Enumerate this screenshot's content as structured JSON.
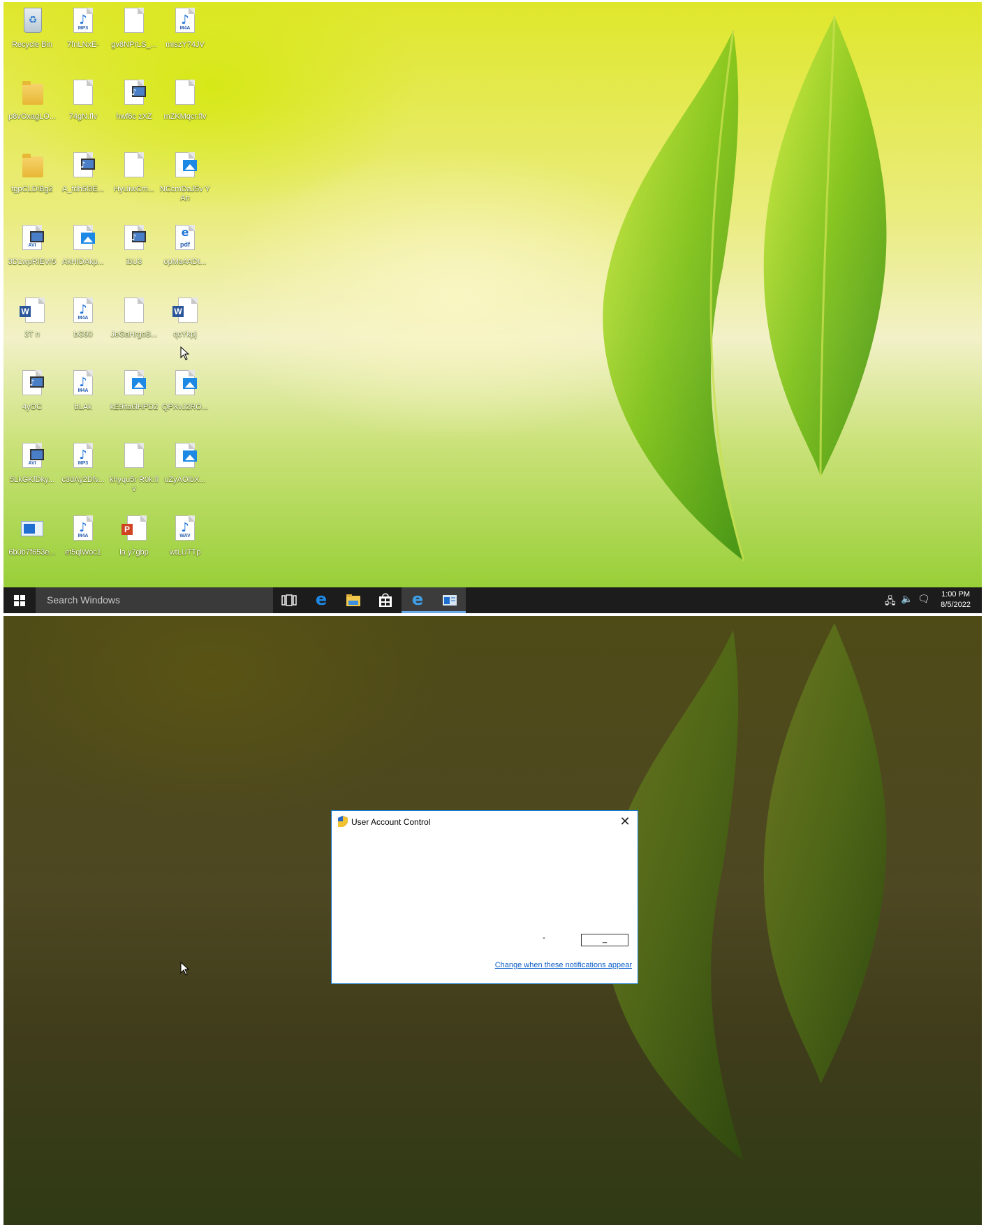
{
  "desktop": {
    "icons": [
      {
        "label": "Recycle Bin",
        "kind": "recycle-bin"
      },
      {
        "label": "7fnLNxE-",
        "kind": "audio",
        "tag": "MP3"
      },
      {
        "label": "gv8NPrLS_...",
        "kind": "blank"
      },
      {
        "label": "mIszY74JV",
        "kind": "audio",
        "tag": "M4A"
      },
      {
        "label": "p8vOxagLO...",
        "kind": "folder"
      },
      {
        "label": "74gN.flv",
        "kind": "blank"
      },
      {
        "label": "hwf6c zXZ",
        "kind": "video-audio"
      },
      {
        "label": "mZKMqcr.flv",
        "kind": "blank"
      },
      {
        "label": "tgpCLDiBg2",
        "kind": "folder"
      },
      {
        "label": "A_fdh5l3E...",
        "kind": "video-audio"
      },
      {
        "label": "HyUiwCm...",
        "kind": "blank"
      },
      {
        "label": "NCcmDaJ5v YAn",
        "kind": "image"
      },
      {
        "label": "3D1wpRlEVr5",
        "kind": "video",
        "tag": "AVI"
      },
      {
        "label": "AkHIDAkp...",
        "kind": "image"
      },
      {
        "label": "ibU3",
        "kind": "video-audio"
      },
      {
        "label": "opMa4ADt...",
        "kind": "pdf",
        "tag": "pdf"
      },
      {
        "label": "3T n",
        "kind": "word"
      },
      {
        "label": "bG90",
        "kind": "audio",
        "tag": "M4A"
      },
      {
        "label": "JeGaHrgoB...",
        "kind": "blank"
      },
      {
        "label": "qcYkpj",
        "kind": "word"
      },
      {
        "label": "4yOC",
        "kind": "video-audio"
      },
      {
        "label": "bLAk",
        "kind": "audio",
        "tag": "M4A"
      },
      {
        "label": "kE9ita6lHPD2",
        "kind": "image"
      },
      {
        "label": "QPXvJ2RO...",
        "kind": "image"
      },
      {
        "label": "5LkGKfDky...",
        "kind": "video",
        "tag": "AVI"
      },
      {
        "label": "c3dAy2Dfv...",
        "kind": "audio",
        "tag": "MP3"
      },
      {
        "label": "khyqu5r R0k.flv",
        "kind": "blank"
      },
      {
        "label": "uZyAOlbX...",
        "kind": "image"
      },
      {
        "label": "6b0b7f653e...",
        "kind": "exe"
      },
      {
        "label": "et5qlWoc1",
        "kind": "audio",
        "tag": "M4A"
      },
      {
        "label": "la y7gbp",
        "kind": "powerpoint"
      },
      {
        "label": "wtLUTTp",
        "kind": "audio",
        "tag": "WAV"
      }
    ]
  },
  "taskbar": {
    "search_placeholder": "Search Windows",
    "buttons": [
      {
        "name": "task-view",
        "icon": "task-view-icon"
      },
      {
        "name": "edge",
        "icon": "edge-icon"
      },
      {
        "name": "file-explorer",
        "icon": "folder-icon"
      },
      {
        "name": "store",
        "icon": "store-icon"
      },
      {
        "name": "internet-explorer",
        "icon": "ie-icon"
      },
      {
        "name": "app-window",
        "icon": "window-icon"
      }
    ],
    "time": "1:00 PM",
    "date": "8/5/2022"
  },
  "uac": {
    "title": "User Account Control",
    "button_a": "-",
    "button_b": "_",
    "link": "Change when these notifications appear"
  },
  "colors": {
    "taskbar": "#1c1c1c",
    "accent": "#1979ca",
    "link": "#0b5ec9"
  }
}
